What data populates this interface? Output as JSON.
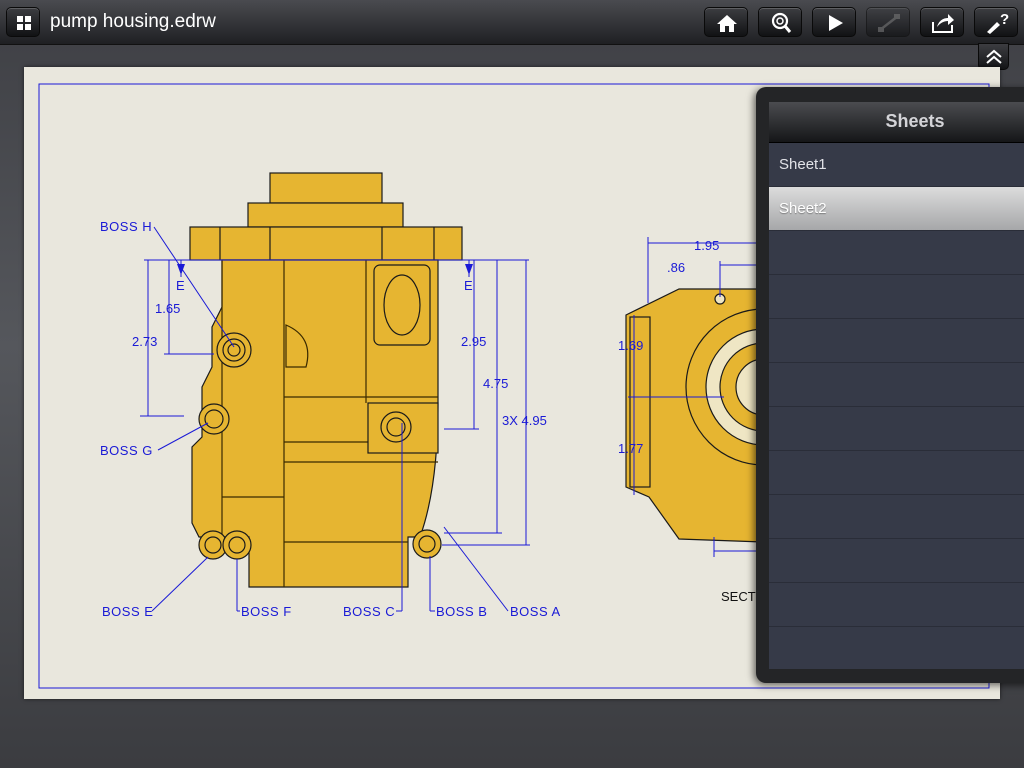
{
  "toolbar": {
    "title": "pump housing.edrw",
    "icons": [
      "grid-menu-icon",
      "home-icon",
      "zoom-icon",
      "play-icon",
      "measure-icon",
      "share-icon",
      "help-icon",
      "collapse-up-icon"
    ]
  },
  "drawing": {
    "labels": {
      "boss_h": "BOSS H",
      "boss_g": "BOSS G",
      "boss_e": "BOSS E",
      "boss_f": "BOSS F",
      "boss_c": "BOSS C",
      "boss_b": "BOSS B",
      "boss_a": "BOSS A",
      "section_mark_left": "E",
      "section_mark_right": "E",
      "section_caption": "SECTION"
    },
    "dimensions": {
      "d165": "1.65",
      "d273": "2.73",
      "d295": "2.95",
      "d475": "4.75",
      "d3x495": "3X 4.95",
      "d195": "1.95",
      "d086": ".86",
      "d169": "1.69",
      "d177": "1.77"
    },
    "colors": {
      "part_fill": "#e6b531",
      "dimension_line": "#1a1ad6",
      "paper": "#e9e7dd"
    }
  },
  "sheets_panel": {
    "title": "Sheets",
    "items": [
      {
        "label": "Sheet1",
        "selected": false
      },
      {
        "label": "Sheet2",
        "selected": true
      }
    ]
  }
}
